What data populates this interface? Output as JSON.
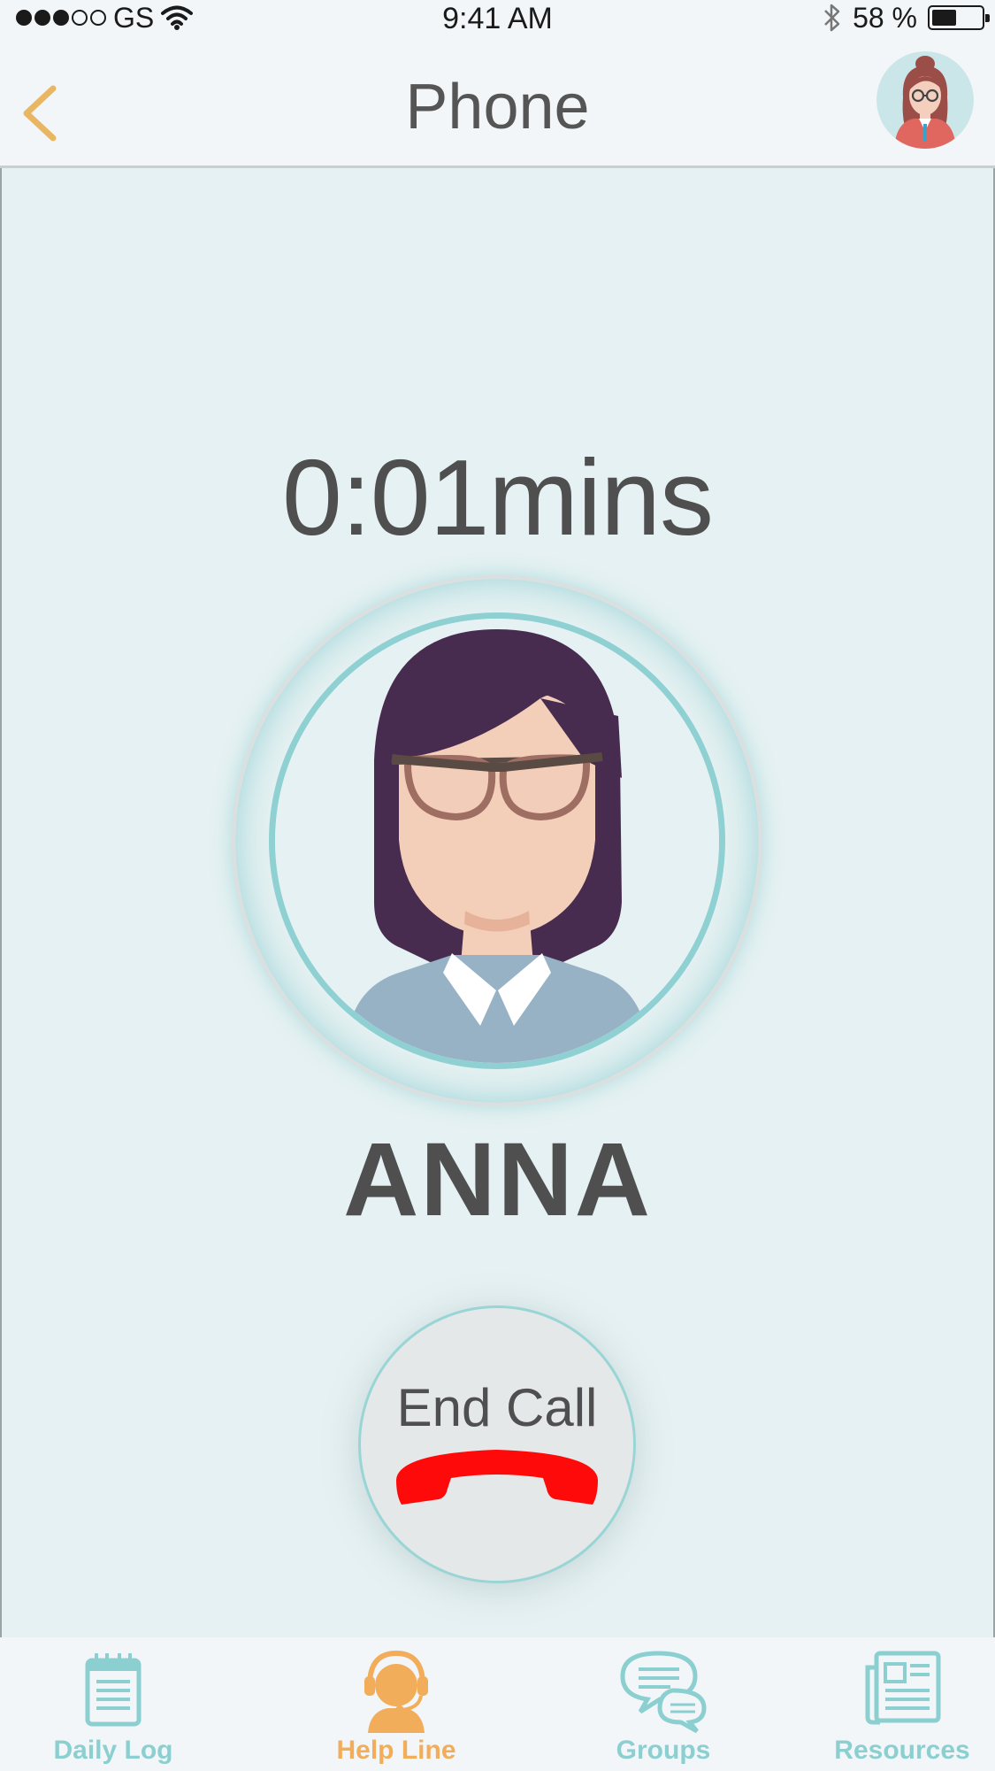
{
  "status_bar": {
    "carrier": "GS",
    "time": "9:41 AM",
    "battery_text": "58 %",
    "signal_bars_filled": 3,
    "signal_bars_total": 5,
    "battery_level": 0.58,
    "icons": [
      "signal-dots-icon",
      "wifi-icon",
      "bluetooth-icon",
      "battery-icon"
    ]
  },
  "nav": {
    "title": "Phone",
    "back_icon": "chevron-left-icon",
    "avatar_icon": "user-avatar-icon",
    "accent_color": "#e9b763"
  },
  "call": {
    "duration": "0:01mins",
    "contact_name": "ANNA",
    "contact_avatar_icon": "contact-avatar-icon",
    "end_call_label": "End Call",
    "end_call_icon": "hang-up-phone-icon",
    "end_call_color": "#ff0a0a",
    "ring_color": "#8fd0d2"
  },
  "tabs": [
    {
      "label": "Daily Log",
      "icon": "notepad-icon",
      "active": false
    },
    {
      "label": "Help Line",
      "icon": "headset-person-icon",
      "active": true
    },
    {
      "label": "Groups",
      "icon": "chat-bubbles-icon",
      "active": false
    },
    {
      "label": "Resources",
      "icon": "newspaper-icon",
      "active": false
    }
  ],
  "colors": {
    "tab_inactive": "#8ccfd1",
    "tab_active": "#f2ad5b",
    "background": "#e5f1f2",
    "text": "#555555"
  }
}
